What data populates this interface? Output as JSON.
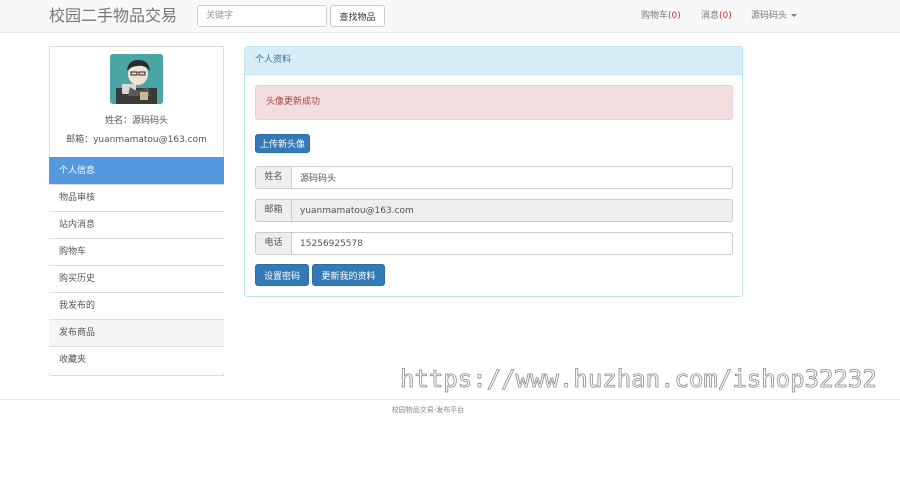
{
  "navbar": {
    "brand": "校园二手物品交易",
    "search_placeholder": "关键字",
    "search_button": "查找物品",
    "cart_label": "购物车",
    "cart_count": "(0)",
    "messages_label": "消息",
    "messages_count": "(0)",
    "user_label": "源码码头"
  },
  "sidebar": {
    "name_line": "姓名：源码码头",
    "email_line": "邮箱：yuanmamatou@163.com",
    "menu": [
      {
        "label": "个人信息"
      },
      {
        "label": "物品审核"
      },
      {
        "label": "站内消息"
      },
      {
        "label": "购物车"
      },
      {
        "label": "购买历史"
      },
      {
        "label": "我发布的"
      },
      {
        "label": "发布商品"
      },
      {
        "label": "收藏夹"
      }
    ]
  },
  "panel": {
    "heading": "个人资料",
    "alert": "头像更新成功",
    "upload_button": "上传新头像",
    "name_label": "姓名",
    "name_value": "源码码头",
    "email_label": "邮箱",
    "email_value": "yuanmamatou@163.com",
    "phone_label": "电话",
    "phone_value": "15256925578",
    "set_password_button": "设置密码",
    "update_button": "更新我的资料"
  },
  "watermark": "https://www.huzhan.com/ishop32232",
  "footer": "校园物品交易-发布平台"
}
